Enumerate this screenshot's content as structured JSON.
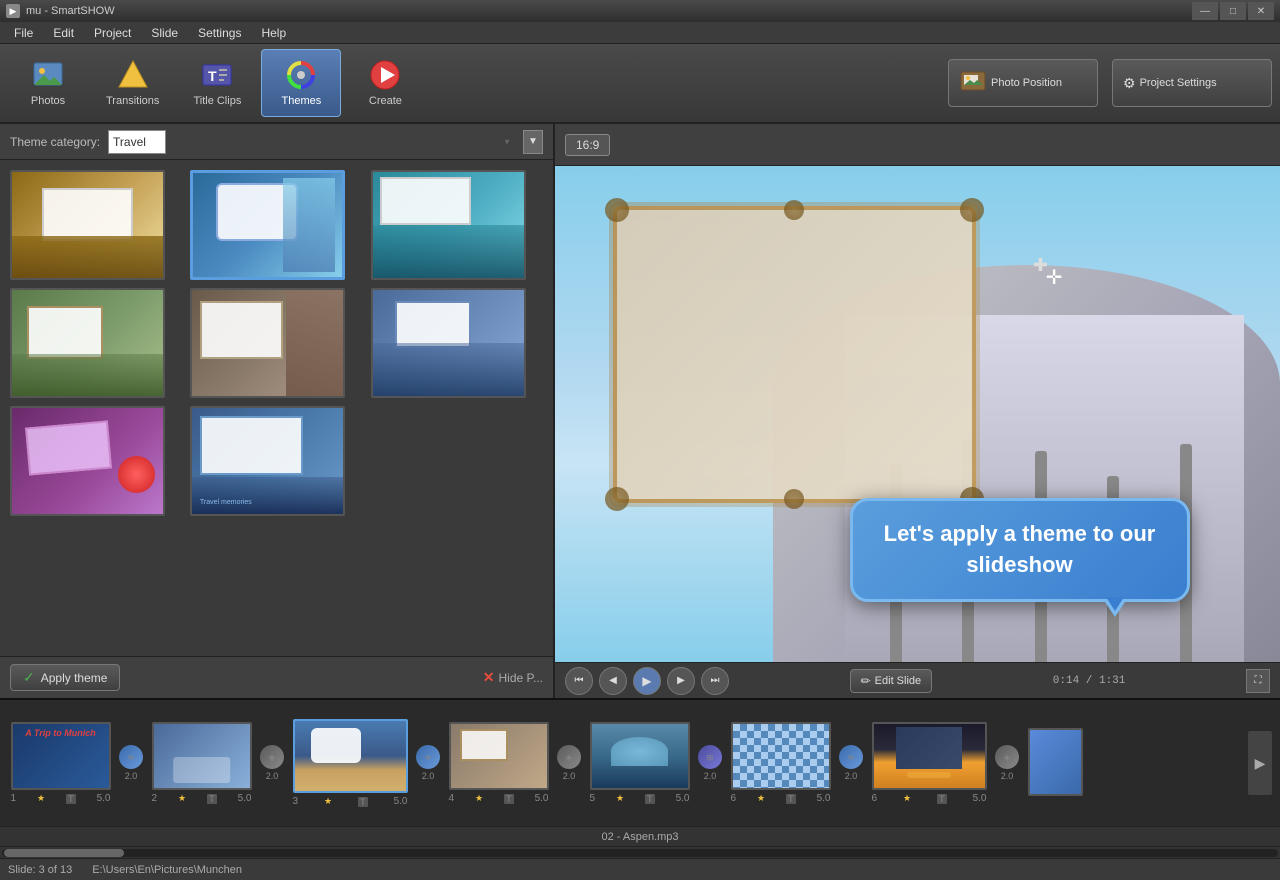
{
  "titleBar": {
    "title": "mu - SmartSHOW",
    "controls": [
      "—",
      "□",
      "✕"
    ]
  },
  "menuBar": {
    "items": [
      "File",
      "Edit",
      "Project",
      "Slide",
      "Settings",
      "Help"
    ]
  },
  "toolbar": {
    "buttons": [
      {
        "id": "photos",
        "label": "Photos",
        "icon": "🖼"
      },
      {
        "id": "transitions",
        "label": "Transitions",
        "icon": "⭐"
      },
      {
        "id": "titleclips",
        "label": "Title Clips",
        "icon": "🎬"
      },
      {
        "id": "themes",
        "label": "Themes",
        "icon": "🎨",
        "active": true
      },
      {
        "id": "create",
        "label": "Create",
        "icon": "🎬"
      }
    ],
    "photoPosition": "Photo Position",
    "projectSettings": "Project Settings"
  },
  "leftPanel": {
    "categoryLabel": "Theme category:",
    "categoryValue": "Travel",
    "applyBtn": "Apply theme",
    "hideBtn": "Hide P..."
  },
  "themes": [
    {
      "id": 1,
      "class": "th1",
      "selected": false
    },
    {
      "id": 2,
      "class": "th2",
      "selected": true
    },
    {
      "id": 3,
      "class": "th3",
      "selected": false
    },
    {
      "id": 4,
      "class": "th4",
      "selected": false
    },
    {
      "id": 5,
      "class": "th5",
      "selected": false
    },
    {
      "id": 6,
      "class": "th6",
      "selected": false
    },
    {
      "id": 7,
      "class": "th7",
      "selected": false
    },
    {
      "id": 8,
      "class": "th8",
      "selected": false
    }
  ],
  "preview": {
    "ratio": "16:9",
    "time": "0:14 / 1:31"
  },
  "tooltip": {
    "text": "Let's apply a theme to our slideshow"
  },
  "editSlide": "Edit Slide",
  "filmstrip": {
    "slides": [
      {
        "num": "1",
        "dur": "5.0",
        "class": "title-slide",
        "title": "A Trip to Munich",
        "hasT": true
      },
      {
        "num": "2",
        "dur": "5.0",
        "class": "t2",
        "hasT": true
      },
      {
        "num": "3",
        "dur": "5.0",
        "class": "t3",
        "selected": true,
        "hasT": true
      },
      {
        "num": "4",
        "dur": "5.0",
        "class": "t4",
        "hasT": true
      },
      {
        "num": "5",
        "dur": "5.0",
        "class": "t5",
        "hasT": true
      },
      {
        "num": "6",
        "dur": "5.0",
        "class": "t6",
        "hasT": true
      }
    ],
    "transitions": [
      {
        "val": "2.0"
      },
      {
        "val": "2.0"
      },
      {
        "val": "2.0"
      },
      {
        "val": "2.0"
      },
      {
        "val": "2.0"
      },
      {
        "val": "2.0"
      }
    ]
  },
  "music": "02 - Aspen.mp3",
  "statusBar": {
    "slide": "Slide: 3 of 13",
    "path": "E:\\Users\\En\\Pictures\\Munchen"
  }
}
